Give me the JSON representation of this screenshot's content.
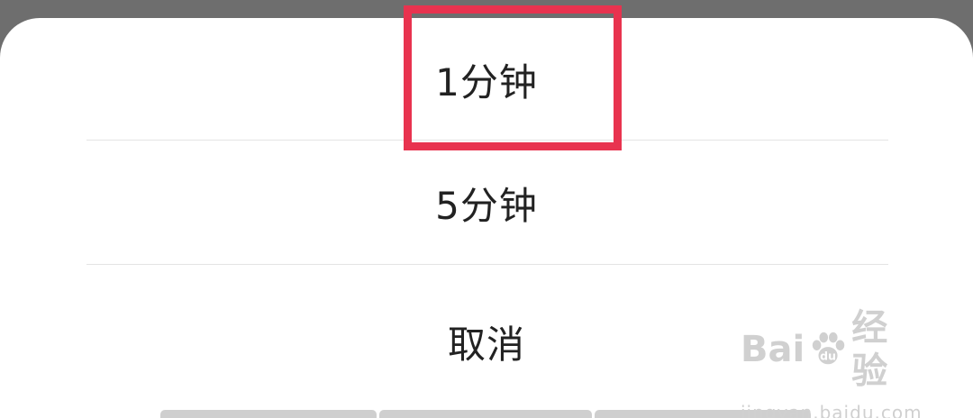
{
  "sheet": {
    "options": [
      {
        "label": "1分钟"
      },
      {
        "label": "5分钟"
      }
    ],
    "cancel_label": "取消"
  },
  "highlight": {
    "color": "#e8334f"
  },
  "watermark": {
    "brand_left": "Bai",
    "brand_mid": "du",
    "brand_right": "经验",
    "url": "jingyan.baidu.com"
  }
}
